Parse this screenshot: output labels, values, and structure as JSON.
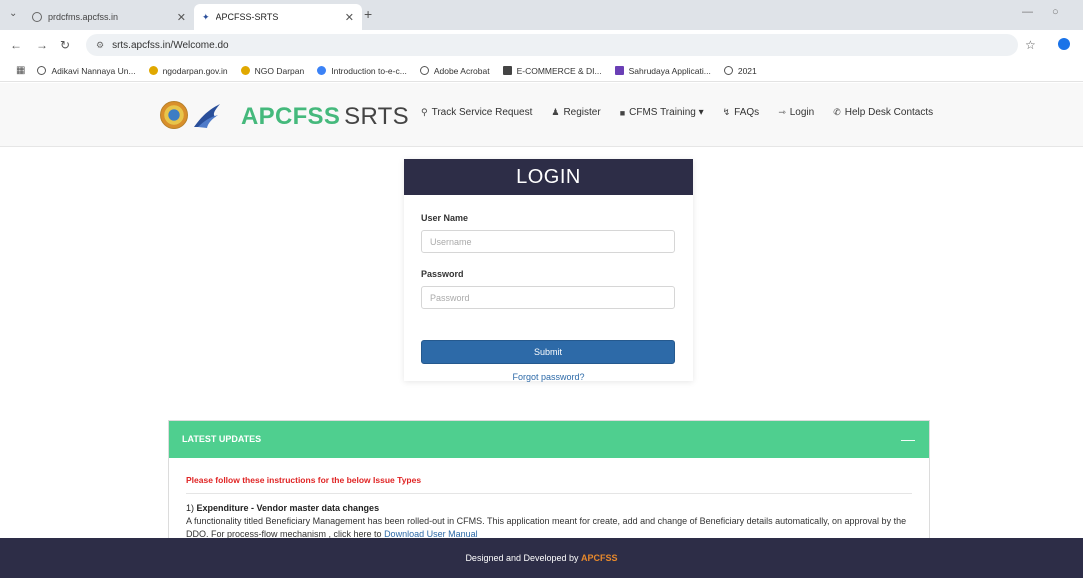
{
  "browser": {
    "tabs": [
      {
        "title": "prdcfms.apcfss.in",
        "active": false
      },
      {
        "title": "APCFSS-SRTS",
        "active": true
      }
    ],
    "new_tab": "+",
    "url": "srts.apcfss.in/Welcome.do",
    "bookmarks": [
      {
        "label": "Adikavi Nannaya Un...",
        "color": "#555555"
      },
      {
        "label": "ngodarpan.gov.in",
        "color": "#e0a800"
      },
      {
        "label": "NGO Darpan",
        "color": "#e0a800"
      },
      {
        "label": "Introduction to-e-c...",
        "color": "#3b82f6"
      },
      {
        "label": "Adobe Acrobat",
        "color": "#555555"
      },
      {
        "label": "E-COMMERCE & DI...",
        "color": "#444444"
      },
      {
        "label": "Sahrudaya Applicati...",
        "color": "#6a3fb5"
      },
      {
        "label": "2021",
        "color": "#555555"
      }
    ]
  },
  "header": {
    "brand_part1": "APCFSS",
    "brand_part2": "SRTS",
    "menu": [
      {
        "label": "Track Service Request",
        "icon": "search-icon"
      },
      {
        "label": "Register",
        "icon": "user-plus-icon"
      },
      {
        "label": "CFMS Training ▾",
        "icon": "video-icon"
      },
      {
        "label": "FAQs",
        "icon": "bolt-icon"
      },
      {
        "label": "Login",
        "icon": "sign-in-icon"
      },
      {
        "label": "Help Desk Contacts",
        "icon": "phone-icon"
      }
    ]
  },
  "login": {
    "title": "LOGIN",
    "username_label": "User Name",
    "username_placeholder": "Username",
    "password_label": "Password",
    "password_placeholder": "Password",
    "submit_label": "Submit",
    "forgot_label": "Forgot password?"
  },
  "updates": {
    "title": "LATEST UPDATES",
    "collapse_symbol": "—",
    "warning": "Please follow these instructions for the below Issue Types",
    "item_number": "1) ",
    "item_title": "Expenditure - Vendor master data changes",
    "item_text": "A functionality titled Beneficiary Management has been rolled-out in CFMS. This application meant for create, add and change of Beneficiary details automatically, on approval by the DDO. For process-flow mechanism , click here to ",
    "item_link": "Download User Manual"
  },
  "footer": {
    "text": "Designed and Developed by ",
    "brand": "APCFSS"
  },
  "colors": {
    "brand_green": "#45b97c",
    "header_dark": "#2d2d47",
    "updates_green": "#4fcf8f",
    "warning_red": "#e02424",
    "link_blue": "#2d6aa8",
    "footer_brand": "#e8892b"
  }
}
